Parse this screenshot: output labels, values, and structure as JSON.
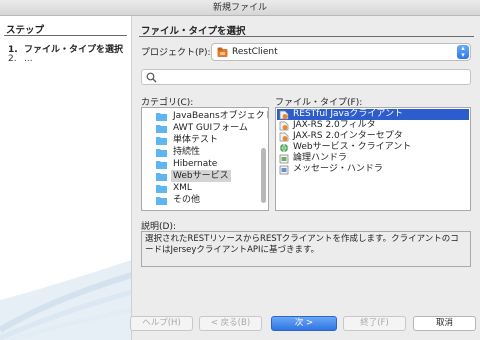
{
  "window": {
    "title": "新規ファイル"
  },
  "steps": {
    "title": "ステップ",
    "items": [
      {
        "num": "1.",
        "label": "ファイル・タイプを選択"
      },
      {
        "num": "2.",
        "label": "..."
      }
    ]
  },
  "section": {
    "title": "ファイル・タイプを選択"
  },
  "project": {
    "label": "プロジェクト(P):",
    "value": "RestClient"
  },
  "search": {
    "placeholder": "",
    "value": ""
  },
  "categories": {
    "label": "カテゴリ(C):",
    "items": [
      {
        "label": "JavaBeansオブジェクト",
        "selected": false
      },
      {
        "label": "AWT GUIフォーム",
        "selected": false
      },
      {
        "label": "単体テスト",
        "selected": false
      },
      {
        "label": "持続性",
        "selected": false
      },
      {
        "label": "Hibernate",
        "selected": false
      },
      {
        "label": "Webサービス",
        "selected": true
      },
      {
        "label": "XML",
        "selected": false
      },
      {
        "label": "その他",
        "selected": false
      }
    ]
  },
  "file_types": {
    "label": "ファイル・タイプ(F):",
    "items": [
      {
        "label": "RESTful Javaクライアント",
        "selected": true,
        "icon": "rest-client-icon"
      },
      {
        "label": "JAX-RS 2.0フィルタ",
        "selected": false,
        "icon": "jaxrs-filter-icon"
      },
      {
        "label": "JAX-RS 2.0インターセプタ",
        "selected": false,
        "icon": "jaxrs-interceptor-icon"
      },
      {
        "label": "Webサービス・クライアント",
        "selected": false,
        "icon": "web-service-client-icon"
      },
      {
        "label": "論理ハンドラ",
        "selected": false,
        "icon": "logical-handler-icon"
      },
      {
        "label": "メッセージ・ハンドラ",
        "selected": false,
        "icon": "message-handler-icon"
      }
    ]
  },
  "description": {
    "label": "説明(D):",
    "text": "選択されたRESTリソースからRESTクライアントを作成します。クライアントのコードはJerseyクライアントAPIに基づきます。"
  },
  "buttons": {
    "help": "ヘルプ(H)",
    "back": "< 戻る(B)",
    "next": "次 >",
    "finish": "終了(F)",
    "cancel": "取消"
  },
  "colors": {
    "accent": "#2d5dcc",
    "selection_gray": "#d4d4d4",
    "folder": "#5eb5f0"
  }
}
